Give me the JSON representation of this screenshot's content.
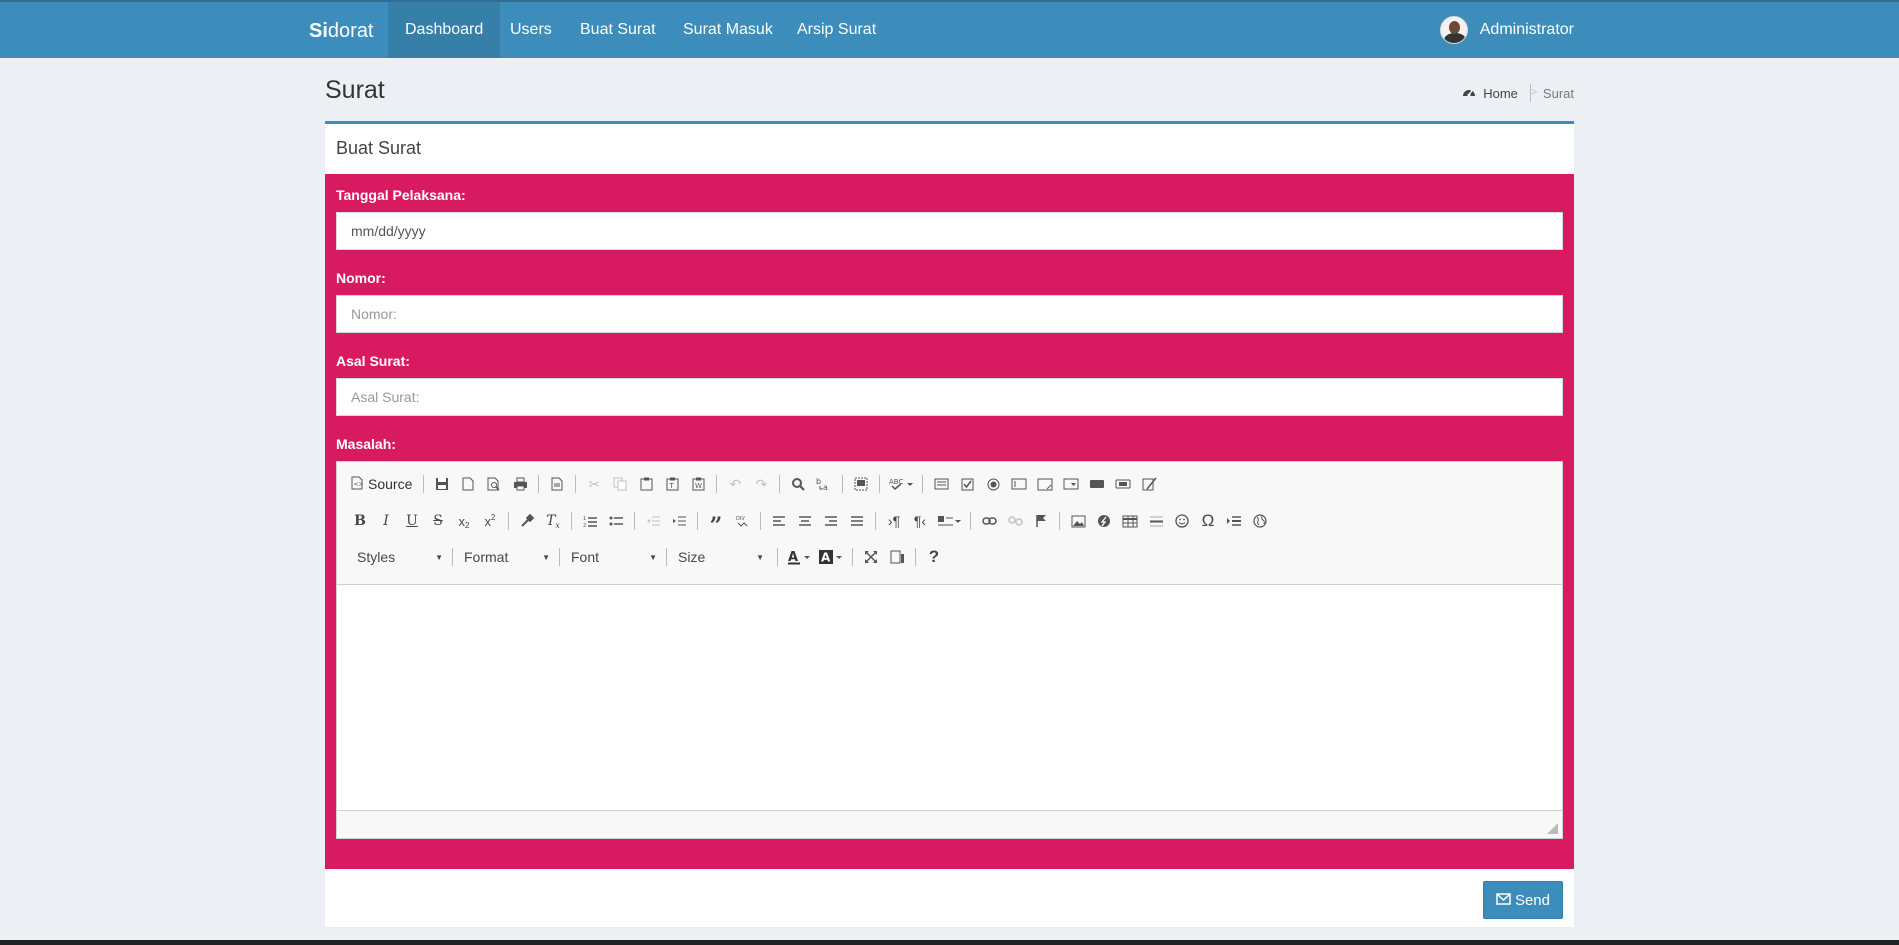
{
  "brand": {
    "bold": "Si",
    "rest": "dorat"
  },
  "nav": [
    {
      "label": "Dashboard"
    },
    {
      "label": "Users"
    },
    {
      "label": "Buat Surat"
    },
    {
      "label": "Surat Masuk"
    },
    {
      "label": "Arsip Surat"
    }
  ],
  "user": {
    "name": "Administrator"
  },
  "page": {
    "title": "Surat"
  },
  "breadcrumb": {
    "home": "Home",
    "sep": ">",
    "current": "Surat"
  },
  "box": {
    "title": "Buat Surat"
  },
  "form": {
    "tanggal_label": "Tanggal Pelaksana:",
    "tanggal_value": "mm/dd/yyyy",
    "nomor_label": "Nomor:",
    "nomor_placeholder": "Nomor:",
    "asal_label": "Asal Surat:",
    "asal_placeholder": "Asal Surat:",
    "masalah_label": "Masalah:"
  },
  "editor": {
    "source_label": "Source",
    "styles_label": "Styles",
    "format_label": "Format",
    "font_label": "Font",
    "size_label": "Size"
  },
  "send": {
    "label": "Send"
  },
  "colors": {
    "nav": "#3c8dbc",
    "form": "#d81b60",
    "background": "#ecf0f5"
  }
}
